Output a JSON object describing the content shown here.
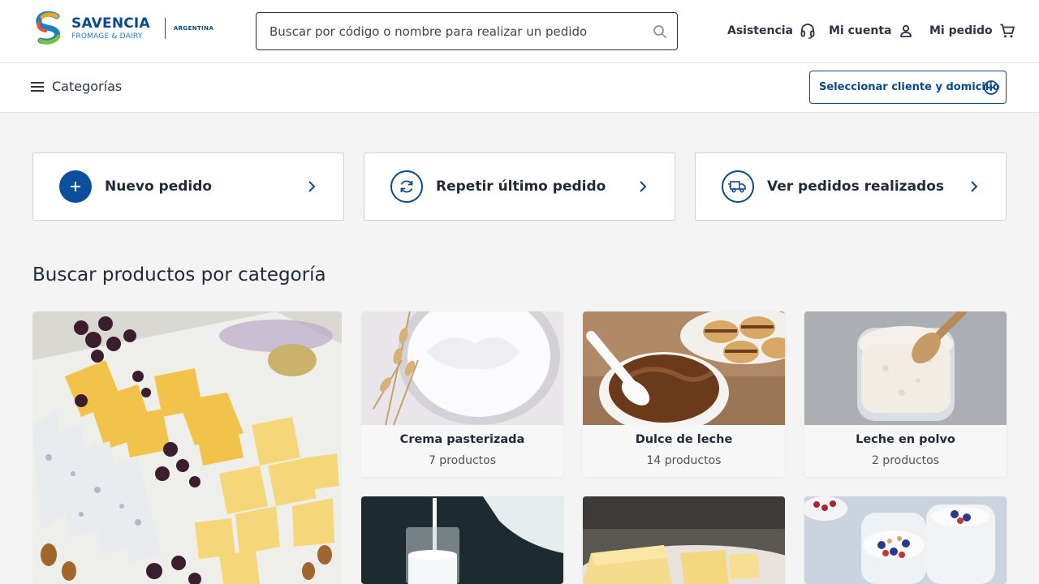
{
  "header": {
    "brand_name": "SAVENCIA",
    "brand_sub": "FROMAGE & DAIRY",
    "brand_country": "ARGENTINA",
    "search_placeholder": "Buscar por código o nombre para realizar un pedido",
    "nav": {
      "assistance": "Asistencia",
      "account": "Mi cuenta",
      "order": "Mi pedido"
    }
  },
  "catbar": {
    "categories_label": "Categorías",
    "select_client_label": "Seleccionar cliente y domicilio"
  },
  "actions": [
    {
      "label": "Nuevo pedido",
      "icon": "plus-icon"
    },
    {
      "label": "Repetir último pedido",
      "icon": "refresh-icon"
    },
    {
      "label": "Ver pedidos realizados",
      "icon": "delivery-truck-icon"
    }
  ],
  "section_title": "Buscar productos por categoría",
  "categories": [
    {
      "title": "Crema pasterizada",
      "count": "7 productos"
    },
    {
      "title": "Dulce de leche",
      "count": "14 productos"
    },
    {
      "title": "Leche en polvo",
      "count": "2 productos"
    }
  ],
  "colors": {
    "brand_blue": "#0a4a8a",
    "primary_button": "#0b4f9c",
    "background": "#f4f4f4"
  }
}
